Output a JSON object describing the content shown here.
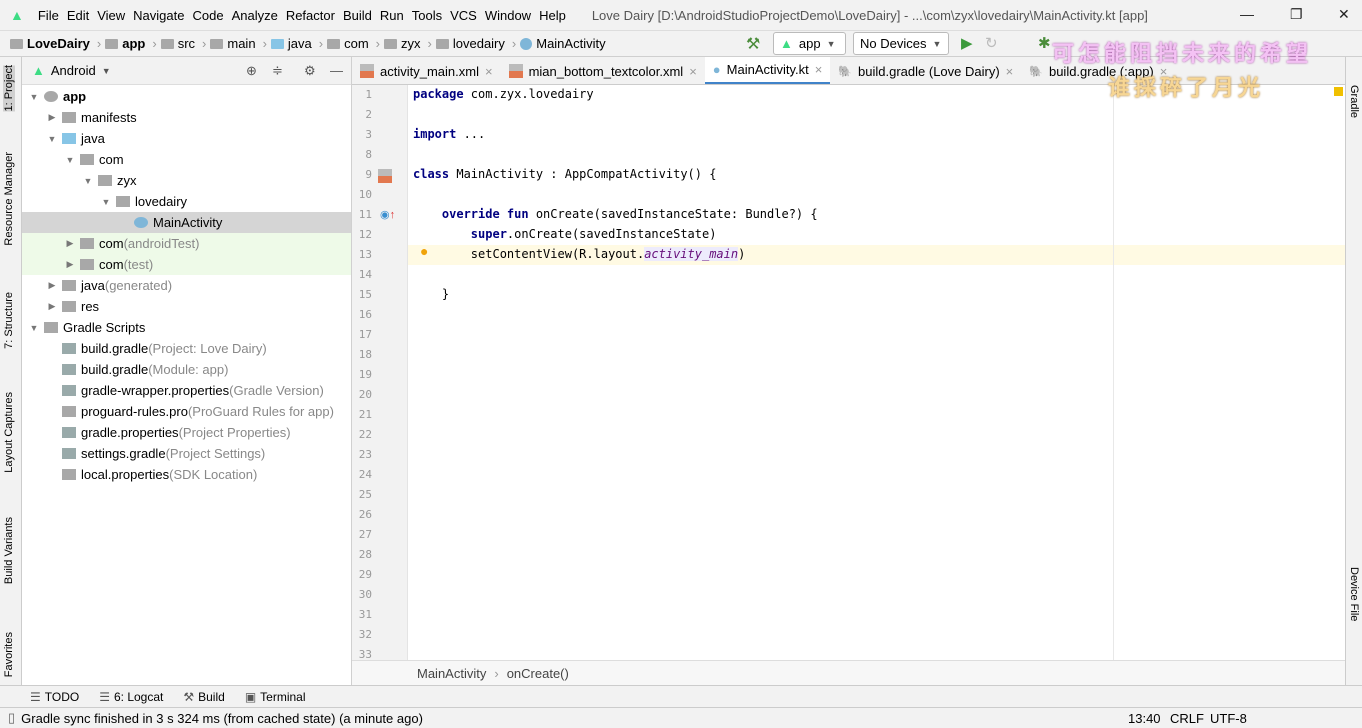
{
  "menubar": {
    "items": [
      "File",
      "Edit",
      "View",
      "Navigate",
      "Code",
      "Analyze",
      "Refactor",
      "Build",
      "Run",
      "Tools",
      "VCS",
      "Window",
      "Help"
    ],
    "title": "Love Dairy [D:\\AndroidStudioProjectDemo\\LoveDairy] - ...\\com\\zyx\\lovedairy\\MainActivity.kt [app]"
  },
  "navbar": {
    "crumbs": [
      "LoveDairy",
      "app",
      "src",
      "main",
      "java",
      "com",
      "zyx",
      "lovedairy",
      "MainActivity"
    ],
    "config": "app",
    "device": "No Devices"
  },
  "overlay": {
    "line1": "可怎能阻挡未来的希望",
    "line2": "谁採碎了月光"
  },
  "left_strip": [
    "1: Project",
    "Resource Manager",
    "7: Structure",
    "Layout Captures",
    "Build Variants",
    "Favorites"
  ],
  "right_strip": [
    "Gradle",
    "Device File"
  ],
  "project": {
    "view": "Android",
    "tree": [
      {
        "label": "app",
        "suffix": "",
        "level": 0,
        "arrow": "▼",
        "bold": true
      },
      {
        "label": "manifests",
        "suffix": "",
        "level": 1,
        "arrow": "▶"
      },
      {
        "label": "java",
        "suffix": "",
        "level": 1,
        "arrow": "▼"
      },
      {
        "label": "com",
        "suffix": "",
        "level": 2,
        "arrow": "▼"
      },
      {
        "label": "zyx",
        "suffix": "",
        "level": 3,
        "arrow": "▼"
      },
      {
        "label": "lovedairy",
        "suffix": "",
        "level": 4,
        "arrow": "▼"
      },
      {
        "label": "MainActivity",
        "suffix": "",
        "level": 5,
        "arrow": "",
        "selected": true
      },
      {
        "label": "com",
        "suffix": " (androidTest)",
        "level": 2,
        "arrow": "▶",
        "green": true
      },
      {
        "label": "com",
        "suffix": " (test)",
        "level": 2,
        "arrow": "▶",
        "green": true
      },
      {
        "label": "java",
        "suffix": " (generated)",
        "level": 1,
        "arrow": "▶"
      },
      {
        "label": "res",
        "suffix": "",
        "level": 1,
        "arrow": "▶"
      },
      {
        "label": "Gradle Scripts",
        "suffix": "",
        "level": 0,
        "arrow": "▼"
      },
      {
        "label": "build.gradle",
        "suffix": " (Project: Love Dairy)",
        "level": 1,
        "arrow": ""
      },
      {
        "label": "build.gradle",
        "suffix": " (Module: app)",
        "level": 1,
        "arrow": ""
      },
      {
        "label": "gradle-wrapper.properties",
        "suffix": " (Gradle Version)",
        "level": 1,
        "arrow": ""
      },
      {
        "label": "proguard-rules.pro",
        "suffix": " (ProGuard Rules for app)",
        "level": 1,
        "arrow": ""
      },
      {
        "label": "gradle.properties",
        "suffix": " (Project Properties)",
        "level": 1,
        "arrow": ""
      },
      {
        "label": "settings.gradle",
        "suffix": " (Project Settings)",
        "level": 1,
        "arrow": ""
      },
      {
        "label": "local.properties",
        "suffix": " (SDK Location)",
        "level": 1,
        "arrow": ""
      }
    ]
  },
  "tabs": [
    {
      "label": "activity_main.xml",
      "icon": "xml"
    },
    {
      "label": "mian_bottom_textcolor.xml",
      "icon": "xml"
    },
    {
      "label": "MainActivity.kt",
      "icon": "kotlin",
      "active": true
    },
    {
      "label": "build.gradle (Love Dairy)",
      "icon": "gradle"
    },
    {
      "label": "build.gradle (:app)",
      "icon": "gradle"
    }
  ],
  "editor": {
    "line_numbers": [
      "1",
      "2",
      "3",
      "8",
      "9",
      "10",
      "11",
      "12",
      "13",
      "14",
      "15",
      "16",
      "17",
      "18",
      "19",
      "20",
      "21",
      "22",
      "23",
      "24",
      "25",
      "26",
      "27",
      "28",
      "29",
      "30",
      "31",
      "32",
      "33"
    ],
    "lines": [
      [
        {
          "t": "package",
          "k": "kw"
        },
        {
          "t": " com.zyx.lovedairy"
        }
      ],
      [],
      [
        {
          "t": "import",
          "k": "kw"
        },
        {
          "t": " ..."
        }
      ],
      [],
      [
        {
          "t": "class",
          "k": "kw"
        },
        {
          "t": " MainActivity : AppCompatActivity() {"
        }
      ],
      [],
      [
        {
          "t": "    "
        },
        {
          "t": "override fun",
          "k": "kw"
        },
        {
          "t": " onCreate(savedInstanceState: Bundle?) {"
        }
      ],
      [
        {
          "t": "        "
        },
        {
          "t": "super",
          "k": "kw"
        },
        {
          "t": ".onCreate(savedInstanceState)"
        }
      ],
      [
        {
          "t": "        setContentView(R.layout."
        },
        {
          "t": "activity_main",
          "k": "it"
        },
        {
          "t": ")"
        }
      ],
      [],
      [
        {
          "t": "    }"
        }
      ]
    ]
  },
  "breadcrumbs": [
    "MainActivity",
    "onCreate()"
  ],
  "toolbar": {
    "items": [
      "TODO",
      "6: Logcat",
      "Build",
      "Terminal"
    ]
  },
  "status": {
    "message": "Gradle sync finished in 3 s 324 ms (from cached state) (a minute ago)",
    "position": "13:40",
    "line_sep": "CRLF",
    "encoding": "UTF-8"
  }
}
